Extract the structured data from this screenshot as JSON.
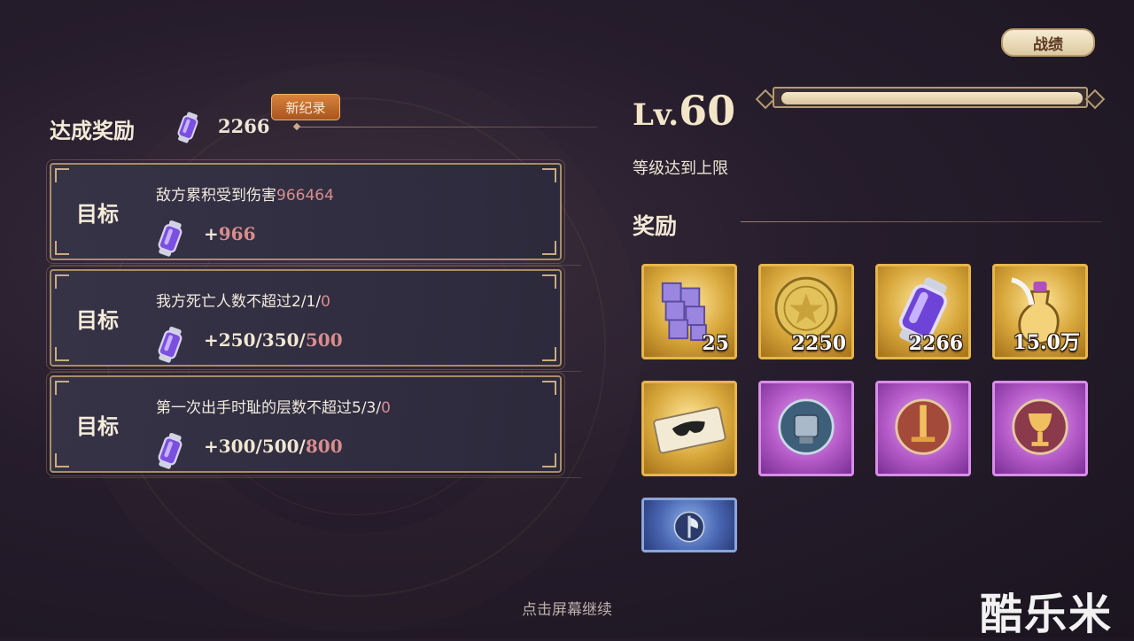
{
  "header": {
    "record_button": "战绩"
  },
  "achievement": {
    "title": "达成奖励",
    "value": "2266",
    "badge": "新纪录"
  },
  "goals": [
    {
      "label": "目标",
      "desc_text": "敌方累积受到伤害",
      "desc_highlight": "966464",
      "reward_text": "+",
      "reward_highlight": "966"
    },
    {
      "label": "目标",
      "desc_text": "我方死亡人数不超过2/1/",
      "desc_highlight": "0",
      "reward_text": "+250/350/",
      "reward_highlight": "500"
    },
    {
      "label": "目标",
      "desc_text": "第一次出手时耻的层数不超过5/3/",
      "desc_highlight": "0",
      "reward_text": "+300/500/",
      "reward_highlight": "800"
    }
  ],
  "level": {
    "prefix": "Lv.",
    "value": "60",
    "progress": 1.0,
    "max_text": "等级达到上限"
  },
  "rewards": {
    "title": "奖励",
    "items": [
      {
        "icon": "purple-cubes-icon",
        "rarity": "gold",
        "qty": "25"
      },
      {
        "icon": "gold-coin-icon",
        "rarity": "gold",
        "qty": "2250"
      },
      {
        "icon": "crystal-vial-icon",
        "rarity": "gold",
        "qty": "2266"
      },
      {
        "icon": "potion-bottle-icon",
        "rarity": "gold",
        "qty": "15.0万"
      },
      {
        "icon": "mask-ticket-icon",
        "rarity": "gold",
        "qty": ""
      },
      {
        "icon": "trophy-emblem-icon",
        "rarity": "purple",
        "qty": ""
      },
      {
        "icon": "sword-emblem-icon",
        "rarity": "purple",
        "qty": ""
      },
      {
        "icon": "goblet-emblem-icon",
        "rarity": "purple",
        "qty": ""
      },
      {
        "icon": "axe-emblem-icon",
        "rarity": "blue",
        "qty": ""
      }
    ]
  },
  "footer": {
    "continue_text": "点击屏幕继续"
  },
  "watermark": "酷乐米",
  "colors": {
    "highlight": "#d98d8d",
    "frame_gold": "#a98d68",
    "accent_badge": "#c66a2c"
  }
}
